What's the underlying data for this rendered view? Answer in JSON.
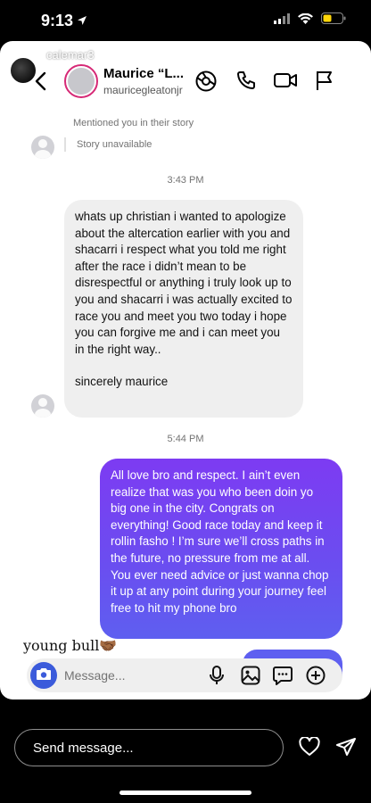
{
  "status_bar": {
    "time": "9:13"
  },
  "story": {
    "username": "calemar3",
    "progress_bars": 5
  },
  "dm": {
    "name": "Maurice “L...",
    "handle": "mauricegleatonjr"
  },
  "chat": {
    "story_mention": "Mentioned you in their story",
    "story_unavailable": "Story unavailable",
    "time_1": "3:43 PM",
    "incoming_message_1": "whats up christian i wanted to apologize about the altercation earlier with you and shacarri i respect what you told me right after the race i didn’t mean to be disrespectful or anything i truly look up to you and shacarri i was actually excited to race you and meet you two today i hope you can forgive me and i can meet you in the right way..",
    "incoming_message_2": "sincerely maurice",
    "time_2": "5:44 PM",
    "outgoing_message": "All love bro and respect. I ain’t even realize that was you who been doin yo big one in the city. Congrats on everything! Good race today and keep it rollin fasho ! I’m sure we’ll cross paths in the future, no pressure from me at all. You ever need advice or just wanna chop it up at any point during your journey feel free to hit my phone bro",
    "overlay_caption": "young bull🤝🏾"
  },
  "composer": {
    "placeholder": "Message..."
  },
  "bottom_bar": {
    "send_placeholder": "Send message..."
  },
  "colors": {
    "outgoing_bubble": "#6a4ef0",
    "incoming_bubble": "#efefef",
    "camera_button": "#3b5bdb"
  }
}
